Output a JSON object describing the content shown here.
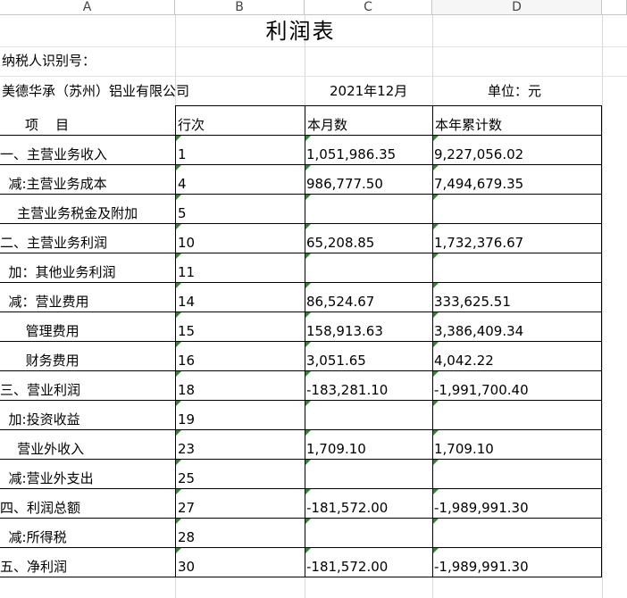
{
  "columns": [
    "A",
    "B",
    "C",
    "D"
  ],
  "title": "利润表",
  "taxpayer_label": "纳税人识别号：",
  "company": "美德华承（苏州）铝业有限公司",
  "period": "2021年12月",
  "unit": "单位：元",
  "headers": {
    "item": "项    目",
    "line": "行次",
    "month": "本月数",
    "ytd": "本年累计数"
  },
  "rows": [
    {
      "item": "一、主营业务收入",
      "line": "1",
      "month": "1,051,986.35",
      "ytd": "9,227,056.02"
    },
    {
      "item": "  减:主营业务成本",
      "line": "4",
      "month": "986,777.50",
      "ytd": "7,494,679.35"
    },
    {
      "item": "    主营业务税金及附加",
      "line": "5",
      "month": "",
      "ytd": ""
    },
    {
      "item": "二、主营业务利润",
      "line": "10",
      "month": "65,208.85",
      "ytd": "1,732,376.67"
    },
    {
      "item": "  加：其他业务利润",
      "line": "11",
      "month": "",
      "ytd": ""
    },
    {
      "item": "  减：营业费用",
      "line": "14",
      "month": "86,524.67",
      "ytd": "333,625.51"
    },
    {
      "item": "      管理费用",
      "line": "15",
      "month": "158,913.63",
      "ytd": "3,386,409.34"
    },
    {
      "item": "      财务费用",
      "line": "16",
      "month": "3,051.65",
      "ytd": "4,042.22"
    },
    {
      "item": "三、营业利润",
      "line": "18",
      "month": "-183,281.10",
      "ytd": "-1,991,700.40"
    },
    {
      "item": "  加:投资收益",
      "line": "19",
      "month": "",
      "ytd": ""
    },
    {
      "item": "    营业外收入",
      "line": "23",
      "month": "1,709.10",
      "ytd": "1,709.10"
    },
    {
      "item": "  减:营业外支出",
      "line": "25",
      "month": "",
      "ytd": ""
    },
    {
      "item": "四、利润总额",
      "line": "27",
      "month": "-181,572.00",
      "ytd": "-1,989,991.30"
    },
    {
      "item": "  减:所得税",
      "line": "28",
      "month": "",
      "ytd": ""
    },
    {
      "item": "五、净利润",
      "line": "30",
      "month": "-181,572.00",
      "ytd": "-1,989,991.30"
    }
  ],
  "colors": {
    "border": "#000000",
    "grid": "#d9d9d9",
    "indicator": "#2a8a2a"
  }
}
